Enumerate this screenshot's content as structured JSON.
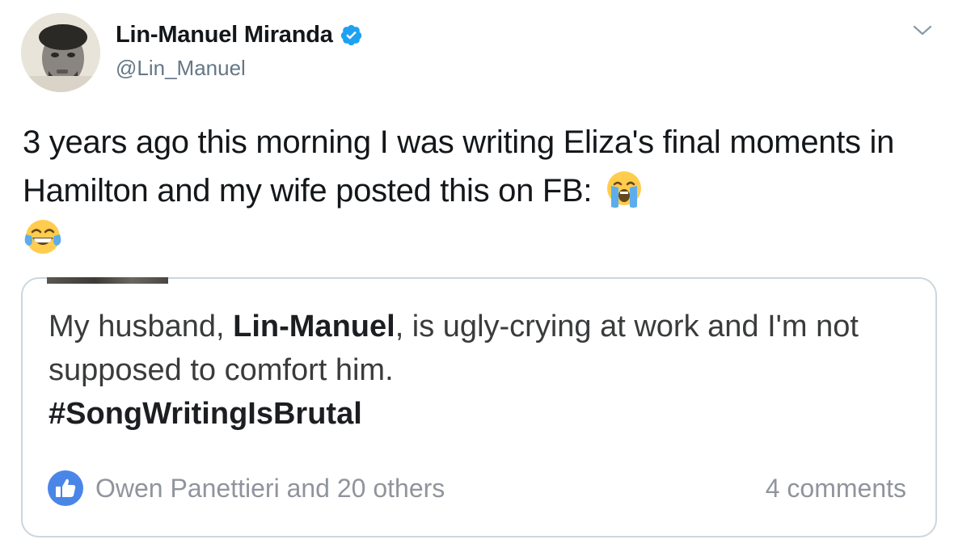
{
  "author": {
    "name": "Lin-Manuel Miranda",
    "handle": "@Lin_Manuel",
    "verified": true
  },
  "tweet": {
    "text": "3 years ago this morning I was writing Eliza's final moments in Hamilton and my wife posted this on FB:",
    "emojis": [
      "loudly-crying-face-emoji",
      "face-with-tears-of-joy-emoji"
    ]
  },
  "quoted_post": {
    "text_before": "My husband, ",
    "text_bold": "Lin-Manuel",
    "text_after": ", is ugly-crying at work and I'm not supposed to comfort him.",
    "hashtag": "#SongWritingIsBrutal",
    "reactions": "Owen Panettieri and 20 others",
    "comments": "4 comments"
  },
  "colors": {
    "verified_blue": "#1da1f2",
    "handle_gray": "#657786",
    "card_border": "#ccd6dd",
    "fb_like_blue": "#4a86e8",
    "fb_meta_gray": "#90949c"
  }
}
